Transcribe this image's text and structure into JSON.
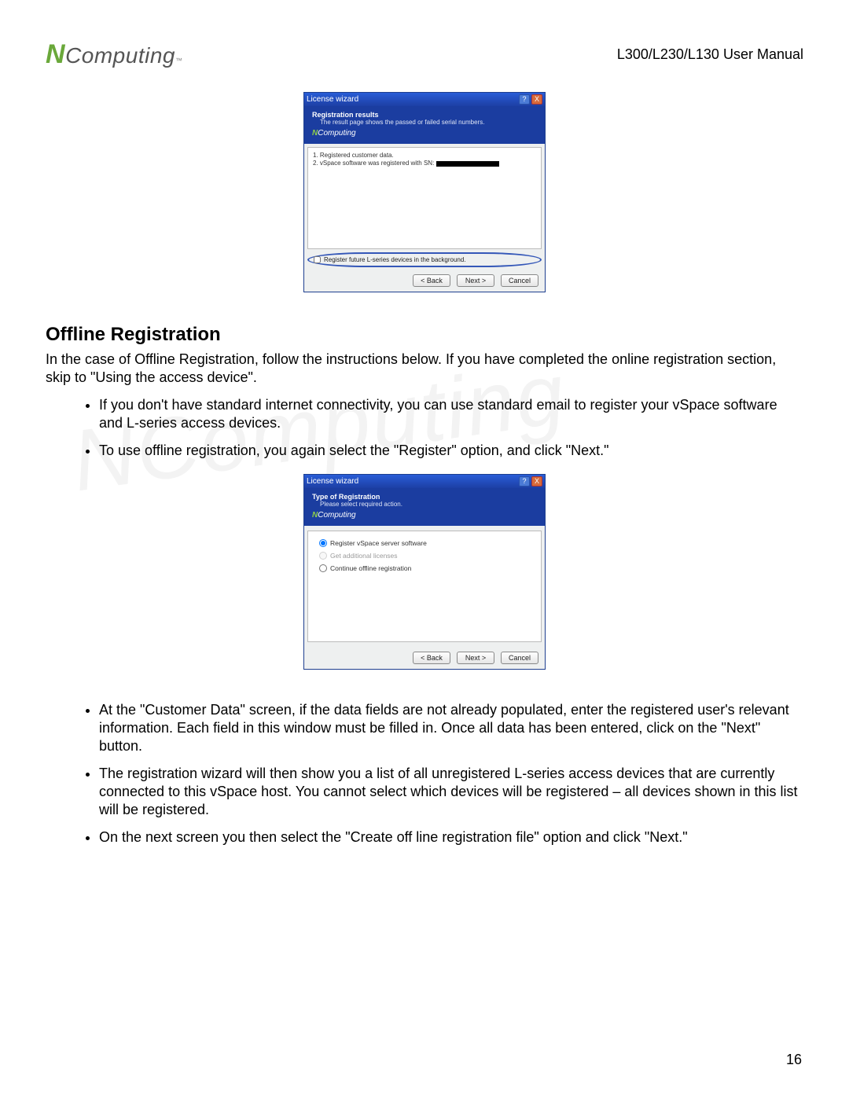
{
  "header": {
    "logo_n": "N",
    "logo_rest": "Computing",
    "logo_tm": "™",
    "manual": "L300/L230/L130 User Manual"
  },
  "dialog1": {
    "title": "License wizard",
    "help": "?",
    "close": "X",
    "band_title": "Registration results",
    "band_sub": "The result page shows the passed or failed serial numbers.",
    "nc_g": "N",
    "nc_w": "Computing",
    "line1": "1. Registered customer data.",
    "line2_pre": "2. vSpace software was registered with SN: ",
    "checkbox_label": "Register future L-series devices in the background.",
    "btn_back": "< Back",
    "btn_next": "Next >",
    "btn_cancel": "Cancel"
  },
  "section_title": "Offline Registration",
  "para1": "In the case of Offline Registration, follow the instructions below. If you have completed the online registration section, skip to \"Using the access device\".",
  "bullets_a": [
    "If you don't have standard internet connectivity, you can use standard email to register your vSpace software and L-series access devices.",
    "To use offline registration, you again select the \"Register\" option, and click \"Next.\""
  ],
  "dialog2": {
    "title": "License wizard",
    "help": "?",
    "close": "X",
    "band_title": "Type of Registration",
    "band_sub": "Please select required action.",
    "nc_g": "N",
    "nc_w": "Computing",
    "opt1": "Register vSpace server software",
    "opt2": "Get additional licenses",
    "opt3": "Continue offline registration",
    "btn_back": "< Back",
    "btn_next": "Next >",
    "btn_cancel": "Cancel"
  },
  "bullets_b": [
    "At the \"Customer Data\" screen, if the data fields are not already populated, enter the registered user's relevant information. Each field in this window must be filled in.   Once all data has been entered, click on the \"Next\" button.",
    "The registration wizard will then show you a list of all unregistered L-series access devices that are currently connected to this vSpace host.   You cannot select which devices will be registered – all devices shown in this list will be registered.",
    "On the next screen you then select the \"Create off line registration file\" option and click \"Next.\""
  ],
  "page_number": "16"
}
